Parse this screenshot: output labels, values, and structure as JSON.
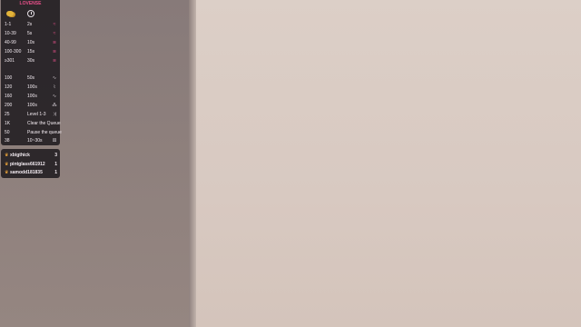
{
  "overlay": {
    "title": "LOVENSE",
    "icons": {
      "left": "coin-icon",
      "right": "clock-icon"
    },
    "levels": [
      {
        "tokens": "1-1",
        "value": "2s",
        "icon": "vibrate-icon"
      },
      {
        "tokens": "10-39",
        "value": "5s",
        "icon": "vibrate-icon"
      },
      {
        "tokens": "40-99",
        "value": "10s",
        "icon": "vibrate-icon"
      },
      {
        "tokens": "100-300",
        "value": "15s",
        "icon": "vibrate-icon"
      },
      {
        "tokens": "≥301",
        "value": "30s",
        "icon": "vibrate-icon"
      }
    ],
    "specials": [
      {
        "tokens": "100",
        "value": "50s",
        "icon": "wave-icon"
      },
      {
        "tokens": "120",
        "value": "100s",
        "icon": "pulse-icon"
      },
      {
        "tokens": "160",
        "value": "100s",
        "icon": "earthquake-icon"
      },
      {
        "tokens": "200",
        "value": "100s",
        "icon": "fireworks-icon"
      },
      {
        "tokens": "25",
        "value": "Level 1-3",
        "icon": "random-icon"
      },
      {
        "tokens": "1K",
        "value": "Clear the Queue",
        "icon": "clear-icon"
      },
      {
        "tokens": "50",
        "value": "Pause the queue",
        "icon": "pause-icon"
      },
      {
        "tokens": "38",
        "value": "10~30s",
        "icon": "random-time-icon"
      }
    ]
  },
  "leaderboard": [
    {
      "name": "xbigthick",
      "count": "3"
    },
    {
      "name": "pintglass661912",
      "count": "1"
    },
    {
      "name": "samodd181835",
      "count": "1"
    }
  ],
  "colors": {
    "accent": "#e8508a",
    "panel": "#121014",
    "wall_left": "#8a7d7b",
    "wall_right": "#d9cbc3"
  }
}
